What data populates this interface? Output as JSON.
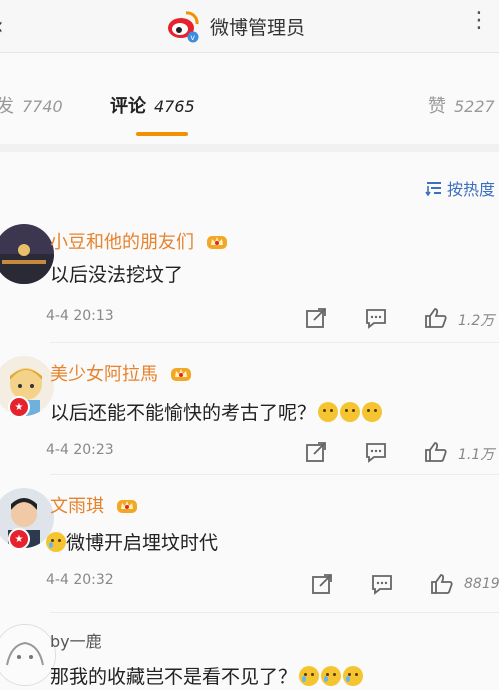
{
  "header": {
    "back_icon": "back-arrow-icon",
    "title": "微博管理员",
    "more_icon": "more-dots-icon"
  },
  "tabs": [
    {
      "label": "发",
      "count": "7740"
    },
    {
      "label": "评论",
      "count": "4765"
    },
    {
      "label": "赞",
      "count": "5227"
    }
  ],
  "sort": {
    "label": "按热度"
  },
  "colors": {
    "accent": "#f29100",
    "username": "#e6832d",
    "link": "#3b6fc0"
  },
  "comments": [
    {
      "user": "小豆和他的朋友们",
      "text": "以后没法挖坟了",
      "time": "4-4 20:13",
      "likes": "1.2万"
    },
    {
      "user": "美少女阿拉馬",
      "text": "以后还能不能愉快的考古了呢？",
      "time": "4-4 20:23",
      "likes": "1.1万"
    },
    {
      "user": "文雨琪",
      "text": "微博开启埋坟时代",
      "time": "4-4 20:32",
      "likes": "8819"
    },
    {
      "user": "by一鹿",
      "text": "那我的收藏岂不是看不见了？"
    }
  ]
}
